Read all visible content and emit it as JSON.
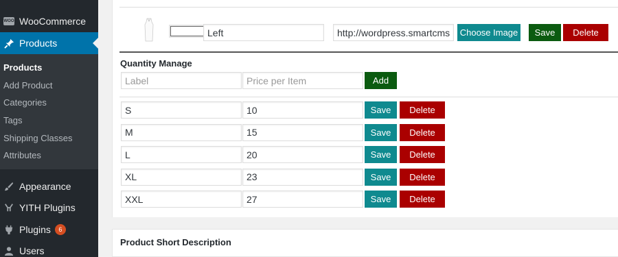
{
  "sidebar": {
    "woocommerce_label": "WooCommerce",
    "woo_icon_text": "WOO",
    "products_label": "Products",
    "submenu": [
      "Products",
      "Add Product",
      "Categories",
      "Tags",
      "Shipping Classes",
      "Attributes"
    ],
    "appearance_label": "Appearance",
    "yith_label": "YITH Plugins",
    "plugins_label": "Plugins",
    "plugins_badge": "6",
    "users_label": "Users"
  },
  "image_row": {
    "name_value": "Left",
    "url_value": "http://wordpress.smartcms",
    "choose_image_label": "Choose Image",
    "save_label": "Save",
    "delete_label": "Delete"
  },
  "quantity": {
    "title": "Quantity Manage",
    "label_placeholder": "Label",
    "price_placeholder": "Price per Item",
    "add_label": "Add",
    "save_label": "Save",
    "delete_label": "Delete",
    "rows": [
      {
        "label": "S",
        "price": "10"
      },
      {
        "label": "M",
        "price": "15"
      },
      {
        "label": "L",
        "price": "20"
      },
      {
        "label": "XL",
        "price": "23"
      },
      {
        "label": "XXL",
        "price": "27"
      }
    ]
  },
  "short_description": {
    "title": "Product Short Description"
  },
  "colors": {
    "sidebar_bg": "#23282d",
    "active_menu": "#0073aa",
    "teal_button": "#0f8a8f",
    "green_button": "#0b5b10",
    "red_button": "#aa0000",
    "badge": "#d54e21"
  }
}
